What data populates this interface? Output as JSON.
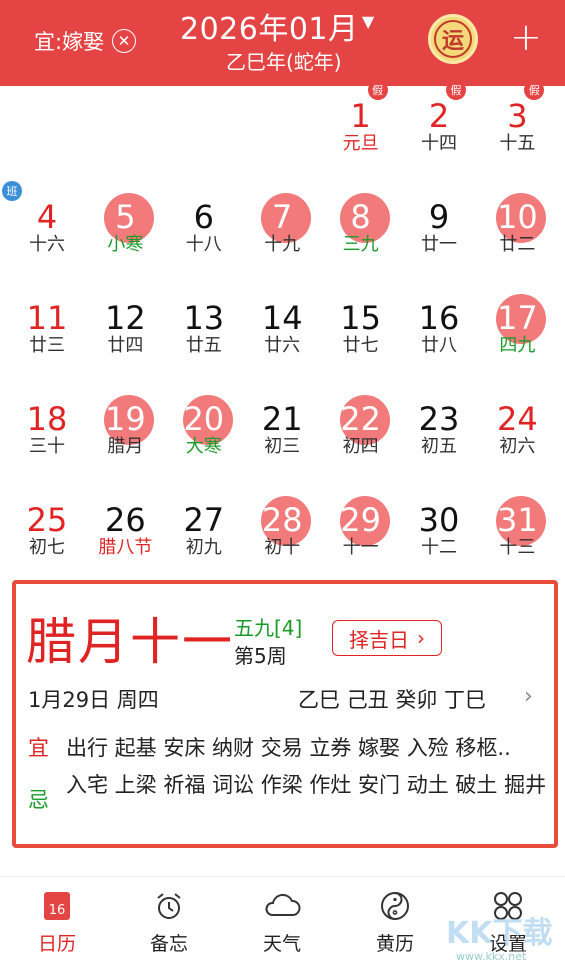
{
  "header": {
    "yi_filter_label": "宜:嫁娶",
    "month_title": "2026年01月",
    "caret": "▼",
    "ganzhi_year": "乙巳年(蛇年)",
    "yun_badge": "运",
    "add_label": "+"
  },
  "tags": {
    "holiday": "假",
    "workday": "班"
  },
  "calendar": {
    "days": [
      {
        "day": "1",
        "lunar": "元旦",
        "day_color": "red",
        "lunar_color": "red",
        "circle": false,
        "tag": "holiday"
      },
      {
        "day": "2",
        "lunar": "十四",
        "day_color": "red",
        "lunar_color": "normal",
        "circle": false,
        "tag": "holiday"
      },
      {
        "day": "3",
        "lunar": "十五",
        "day_color": "red",
        "lunar_color": "normal",
        "circle": false,
        "tag": "holiday"
      },
      {
        "day": "4",
        "lunar": "十六",
        "day_color": "red",
        "lunar_color": "normal",
        "circle": false,
        "tag": "workday"
      },
      {
        "day": "5",
        "lunar": "小寒",
        "day_color": "white",
        "lunar_color": "green",
        "circle": true,
        "tag": ""
      },
      {
        "day": "6",
        "lunar": "十八",
        "day_color": "black",
        "lunar_color": "normal",
        "circle": false,
        "tag": ""
      },
      {
        "day": "7",
        "lunar": "十九",
        "day_color": "white",
        "lunar_color": "normal",
        "circle": true,
        "tag": ""
      },
      {
        "day": "8",
        "lunar": "三九",
        "day_color": "white",
        "lunar_color": "green",
        "circle": true,
        "tag": ""
      },
      {
        "day": "9",
        "lunar": "廿一",
        "day_color": "black",
        "lunar_color": "normal",
        "circle": false,
        "tag": ""
      },
      {
        "day": "10",
        "lunar": "廿二",
        "day_color": "white",
        "lunar_color": "normal",
        "circle": true,
        "tag": ""
      },
      {
        "day": "11",
        "lunar": "廿三",
        "day_color": "red",
        "lunar_color": "normal",
        "circle": false,
        "tag": ""
      },
      {
        "day": "12",
        "lunar": "廿四",
        "day_color": "black",
        "lunar_color": "normal",
        "circle": false,
        "tag": ""
      },
      {
        "day": "13",
        "lunar": "廿五",
        "day_color": "black",
        "lunar_color": "normal",
        "circle": false,
        "tag": ""
      },
      {
        "day": "14",
        "lunar": "廿六",
        "day_color": "black",
        "lunar_color": "normal",
        "circle": false,
        "tag": ""
      },
      {
        "day": "15",
        "lunar": "廿七",
        "day_color": "black",
        "lunar_color": "normal",
        "circle": false,
        "tag": ""
      },
      {
        "day": "16",
        "lunar": "廿八",
        "day_color": "black",
        "lunar_color": "normal",
        "circle": false,
        "tag": ""
      },
      {
        "day": "17",
        "lunar": "四九",
        "day_color": "white",
        "lunar_color": "green",
        "circle": true,
        "tag": ""
      },
      {
        "day": "18",
        "lunar": "三十",
        "day_color": "red",
        "lunar_color": "normal",
        "circle": false,
        "tag": ""
      },
      {
        "day": "19",
        "lunar": "腊月",
        "day_color": "white",
        "lunar_color": "normal",
        "circle": true,
        "tag": ""
      },
      {
        "day": "20",
        "lunar": "大寒",
        "day_color": "white",
        "lunar_color": "green",
        "circle": true,
        "tag": ""
      },
      {
        "day": "21",
        "lunar": "初三",
        "day_color": "black",
        "lunar_color": "normal",
        "circle": false,
        "tag": ""
      },
      {
        "day": "22",
        "lunar": "初四",
        "day_color": "white",
        "lunar_color": "normal",
        "circle": true,
        "tag": ""
      },
      {
        "day": "23",
        "lunar": "初五",
        "day_color": "black",
        "lunar_color": "normal",
        "circle": false,
        "tag": ""
      },
      {
        "day": "24",
        "lunar": "初六",
        "day_color": "red",
        "lunar_color": "normal",
        "circle": false,
        "tag": ""
      },
      {
        "day": "25",
        "lunar": "初七",
        "day_color": "red",
        "lunar_color": "normal",
        "circle": false,
        "tag": ""
      },
      {
        "day": "26",
        "lunar": "腊八节",
        "day_color": "black",
        "lunar_color": "red",
        "circle": false,
        "tag": ""
      },
      {
        "day": "27",
        "lunar": "初九",
        "day_color": "black",
        "lunar_color": "normal",
        "circle": false,
        "tag": ""
      },
      {
        "day": "28",
        "lunar": "初十",
        "day_color": "white",
        "lunar_color": "normal",
        "circle": true,
        "tag": ""
      },
      {
        "day": "29",
        "lunar": "十一",
        "day_color": "white",
        "lunar_color": "normal",
        "circle": true,
        "tag": ""
      },
      {
        "day": "30",
        "lunar": "十二",
        "day_color": "black",
        "lunar_color": "normal",
        "circle": false,
        "tag": ""
      },
      {
        "day": "31",
        "lunar": "十三",
        "day_color": "white",
        "lunar_color": "normal",
        "circle": true,
        "tag": ""
      }
    ]
  },
  "card": {
    "big_lunar": "腊月十一",
    "jiujiu": "五九[4]",
    "week": "第5周",
    "zeji_label": "择吉日",
    "zeji_chevron": "›",
    "solar_date": "1月29日 周四",
    "ganzhi_day": "乙巳  己丑  癸卯  丁巳",
    "detail_chevron": "›",
    "yi_label": "宜",
    "yi_text": "出行 起基 安床 纳财 交易 立券 嫁娶 入殓 移柩..",
    "ji_label": "忌",
    "ji_text": "入宅 上梁 祈福 词讼 作梁 作灶 安门 动土 破土 掘井"
  },
  "nav": {
    "items": [
      {
        "label": "日历",
        "icon": "calendar-icon",
        "active": true
      },
      {
        "label": "备忘",
        "icon": "alarm-clock-icon",
        "active": false
      },
      {
        "label": "天气",
        "icon": "cloud-icon",
        "active": false
      },
      {
        "label": "黄历",
        "icon": "yin-yang-icon",
        "active": false
      },
      {
        "label": "设置",
        "icon": "grid-icon",
        "active": false
      }
    ],
    "calendar_icon_number": "16"
  },
  "watermark": {
    "text": "KK下载",
    "url": "www.kkx.net"
  },
  "colors": {
    "brand_red": "#e54444",
    "circle": "#f27a7a",
    "green": "#1a9b2a"
  }
}
